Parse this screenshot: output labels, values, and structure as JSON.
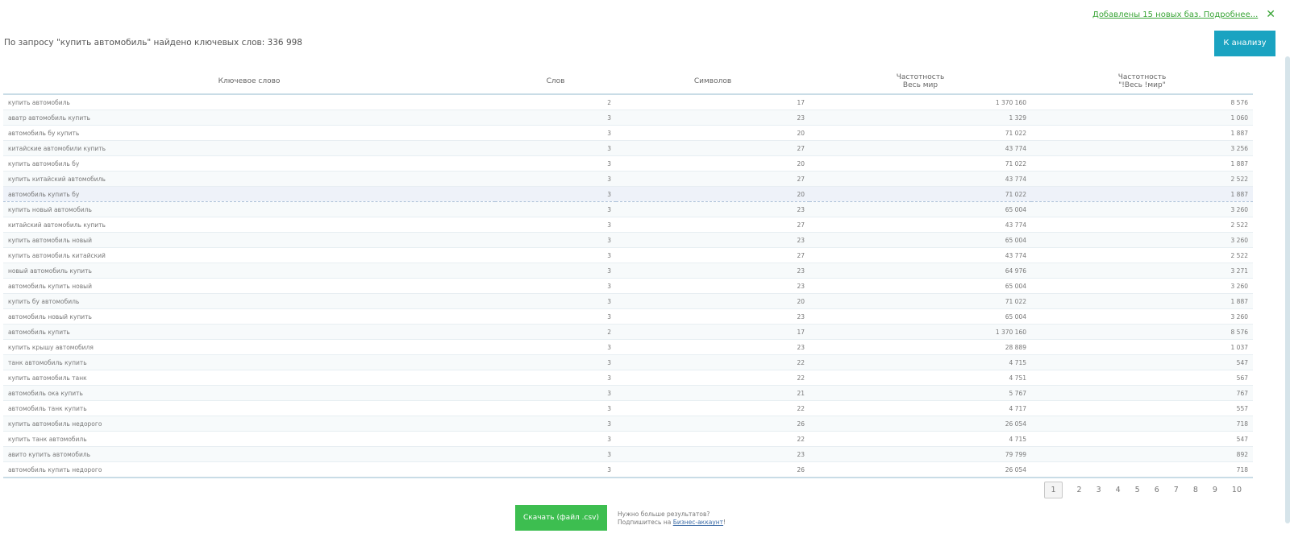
{
  "notice": {
    "text": "Добавлены 15 новых баз. Подробнее...",
    "close": "✕"
  },
  "header": {
    "title": "По запросу \"купить автомобиль\" найдено ключевых слов: 336 998",
    "analyze_button": "К анализу"
  },
  "table": {
    "headers": {
      "keyword": "Ключевое слово",
      "words": "Слов",
      "chars": "Символов",
      "freq1_line1": "Частотность",
      "freq1_line2": "Весь мир",
      "freq2_line1": "Частотность",
      "freq2_line2": "\"!Весь !мир\""
    },
    "rows": [
      {
        "keyword": "купить автомобиль",
        "words": "2",
        "chars": "17",
        "freq": "1 370 160",
        "exact": "8 576"
      },
      {
        "keyword": "аватр автомобиль купить",
        "words": "3",
        "chars": "23",
        "freq": "1 329",
        "exact": "1 060"
      },
      {
        "keyword": "автомобиль бу купить",
        "words": "3",
        "chars": "20",
        "freq": "71 022",
        "exact": "1 887"
      },
      {
        "keyword": "китайские автомобили купить",
        "words": "3",
        "chars": "27",
        "freq": "43 774",
        "exact": "3 256"
      },
      {
        "keyword": "купить автомобиль бу",
        "words": "3",
        "chars": "20",
        "freq": "71 022",
        "exact": "1 887"
      },
      {
        "keyword": "купить китайский автомобиль",
        "words": "3",
        "chars": "27",
        "freq": "43 774",
        "exact": "2 522"
      },
      {
        "keyword": "автомобиль купить бу",
        "words": "3",
        "chars": "20",
        "freq": "71 022",
        "exact": "1 887"
      },
      {
        "keyword": "купить новый автомобиль",
        "words": "3",
        "chars": "23",
        "freq": "65 004",
        "exact": "3 260"
      },
      {
        "keyword": "китайский автомобиль купить",
        "words": "3",
        "chars": "27",
        "freq": "43 774",
        "exact": "2 522"
      },
      {
        "keyword": "купить автомобиль новый",
        "words": "3",
        "chars": "23",
        "freq": "65 004",
        "exact": "3 260"
      },
      {
        "keyword": "купить автомобиль китайский",
        "words": "3",
        "chars": "27",
        "freq": "43 774",
        "exact": "2 522"
      },
      {
        "keyword": "новый автомобиль купить",
        "words": "3",
        "chars": "23",
        "freq": "64 976",
        "exact": "3 271"
      },
      {
        "keyword": "автомобиль купить новый",
        "words": "3",
        "chars": "23",
        "freq": "65 004",
        "exact": "3 260"
      },
      {
        "keyword": "купить бу автомобиль",
        "words": "3",
        "chars": "20",
        "freq": "71 022",
        "exact": "1 887"
      },
      {
        "keyword": "автомобиль новый купить",
        "words": "3",
        "chars": "23",
        "freq": "65 004",
        "exact": "3 260"
      },
      {
        "keyword": "автомобиль купить",
        "words": "2",
        "chars": "17",
        "freq": "1 370 160",
        "exact": "8 576"
      },
      {
        "keyword": "купить крышу автомобиля",
        "words": "3",
        "chars": "23",
        "freq": "28 889",
        "exact": "1 037"
      },
      {
        "keyword": "танк автомобиль купить",
        "words": "3",
        "chars": "22",
        "freq": "4 715",
        "exact": "547"
      },
      {
        "keyword": "купить автомобиль танк",
        "words": "3",
        "chars": "22",
        "freq": "4 751",
        "exact": "567"
      },
      {
        "keyword": "автомобиль ока купить",
        "words": "3",
        "chars": "21",
        "freq": "5 767",
        "exact": "767"
      },
      {
        "keyword": "автомобиль танк купить",
        "words": "3",
        "chars": "22",
        "freq": "4 717",
        "exact": "557"
      },
      {
        "keyword": "купить автомобиль недорого",
        "words": "3",
        "chars": "26",
        "freq": "26 054",
        "exact": "718"
      },
      {
        "keyword": "купить танк автомобиль",
        "words": "3",
        "chars": "22",
        "freq": "4 715",
        "exact": "547"
      },
      {
        "keyword": "авито купить автомобиль",
        "words": "3",
        "chars": "23",
        "freq": "79 799",
        "exact": "892"
      },
      {
        "keyword": "автомобиль купить недорого",
        "words": "3",
        "chars": "26",
        "freq": "26 054",
        "exact": "718"
      }
    ],
    "selected_row": 6
  },
  "pagination": {
    "pages": [
      "1",
      "2",
      "3",
      "4",
      "5",
      "6",
      "7",
      "8",
      "9",
      "10"
    ],
    "active": 0
  },
  "footer": {
    "download_button": "Скачать (файл .csv)",
    "more_line1": "Нужно больше результатов?",
    "more_line2_prefix": "Подпишитесь на ",
    "more_link": "Бизнес-аккаунт",
    "more_suffix": "!"
  }
}
